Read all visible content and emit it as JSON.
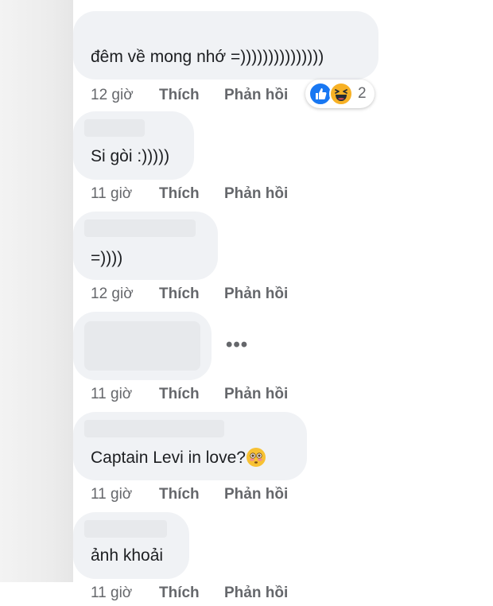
{
  "colors": {
    "bubble": "#f0f2f5",
    "meta_text": "#65676b",
    "like_blue": "#1877f2",
    "haha_yellow": "#f7b125"
  },
  "comments": [
    {
      "text": "đêm về mong nhớ =)))))))))))))))",
      "time": "12 giờ",
      "like": "Thích",
      "reply": "Phản hồi",
      "reactions": {
        "icons": [
          "like-icon",
          "haha-icon"
        ],
        "count": "2"
      }
    },
    {
      "text": "Si gòi :)))))",
      "time": "11 giờ",
      "like": "Thích",
      "reply": "Phản hồi"
    },
    {
      "text": "=))))",
      "time": "12 giờ",
      "like": "Thích",
      "reply": "Phản hồi"
    },
    {
      "text": "",
      "more": "•••",
      "time": "11 giờ",
      "like": "Thích",
      "reply": "Phản hồi"
    },
    {
      "text": "Captain Levi in love?",
      "emoji": "flushed-face-emoji",
      "time": "11 giờ",
      "like": "Thích",
      "reply": "Phản hồi"
    },
    {
      "text": "ảnh khoải",
      "time": "11 giờ",
      "like": "Thích",
      "reply": "Phản hồi"
    }
  ]
}
